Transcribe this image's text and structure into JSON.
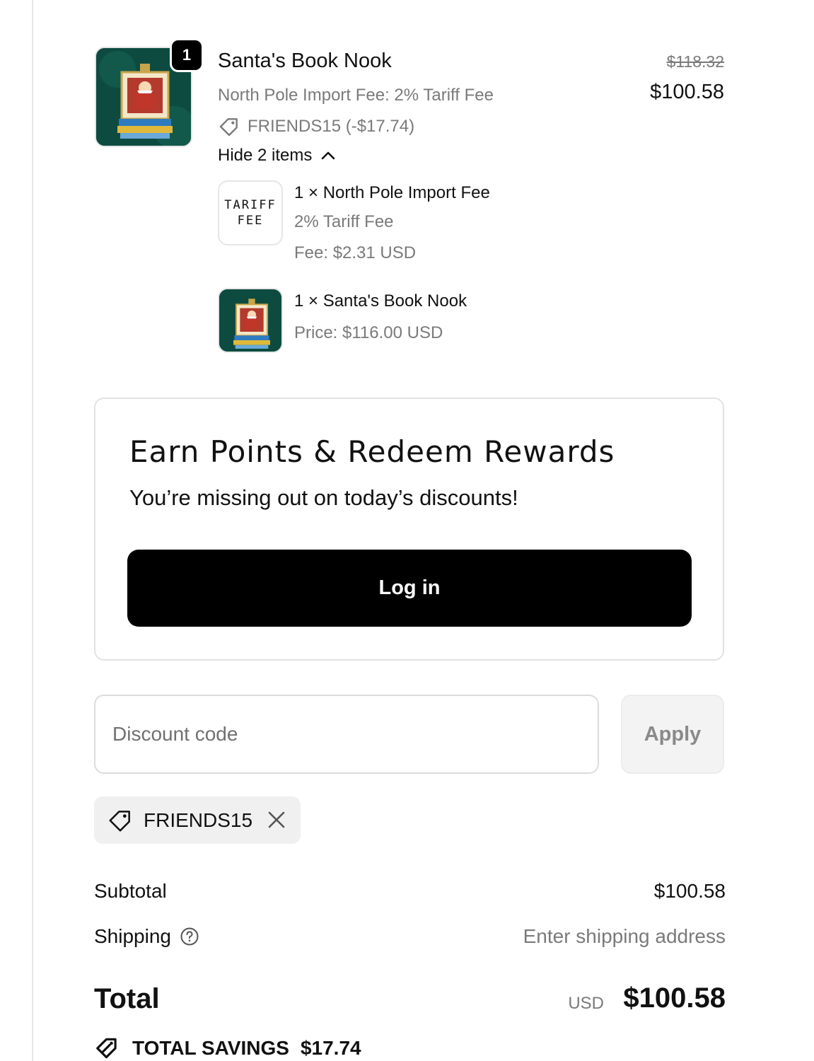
{
  "line_item": {
    "title": "Santa's Book Nook",
    "quantity": "1",
    "variant": "North Pole Import Fee: 2% Tariff Fee",
    "discount": "FRIENDS15 (-$17.74)",
    "toggle_label": "Hide 2 items",
    "price_original": "$118.32",
    "price_current": "$100.58",
    "thumbnail_icon": "ornament-image",
    "sub_items": [
      {
        "thumb_line1": "TARIFF",
        "thumb_line2": "FEE",
        "name": "1 × North Pole Import Fee",
        "detail": "2% Tariff Fee",
        "price": "Fee: $2.31 USD"
      },
      {
        "name": "1 × Santa's Book Nook",
        "price": "Price: $116.00 USD"
      }
    ]
  },
  "rewards": {
    "title": "Earn Points & Redeem Rewards",
    "subtitle": "You’re missing out on today’s discounts!",
    "login_label": "Log in"
  },
  "discount_form": {
    "placeholder": "Discount code",
    "value": "",
    "apply_label": "Apply",
    "applied_code": "FRIENDS15"
  },
  "summary": {
    "subtotal_label": "Subtotal",
    "subtotal_value": "$100.58",
    "shipping_label": "Shipping",
    "shipping_value": "Enter shipping address",
    "total_label": "Total",
    "total_currency": "USD",
    "total_value": "$100.58",
    "savings_label": "TOTAL SAVINGS",
    "savings_value": "$17.74"
  },
  "colors": {
    "primary_button": "#000000",
    "muted_text": "#7a7a7a",
    "thumbnail_bg": "#0d4b40"
  }
}
